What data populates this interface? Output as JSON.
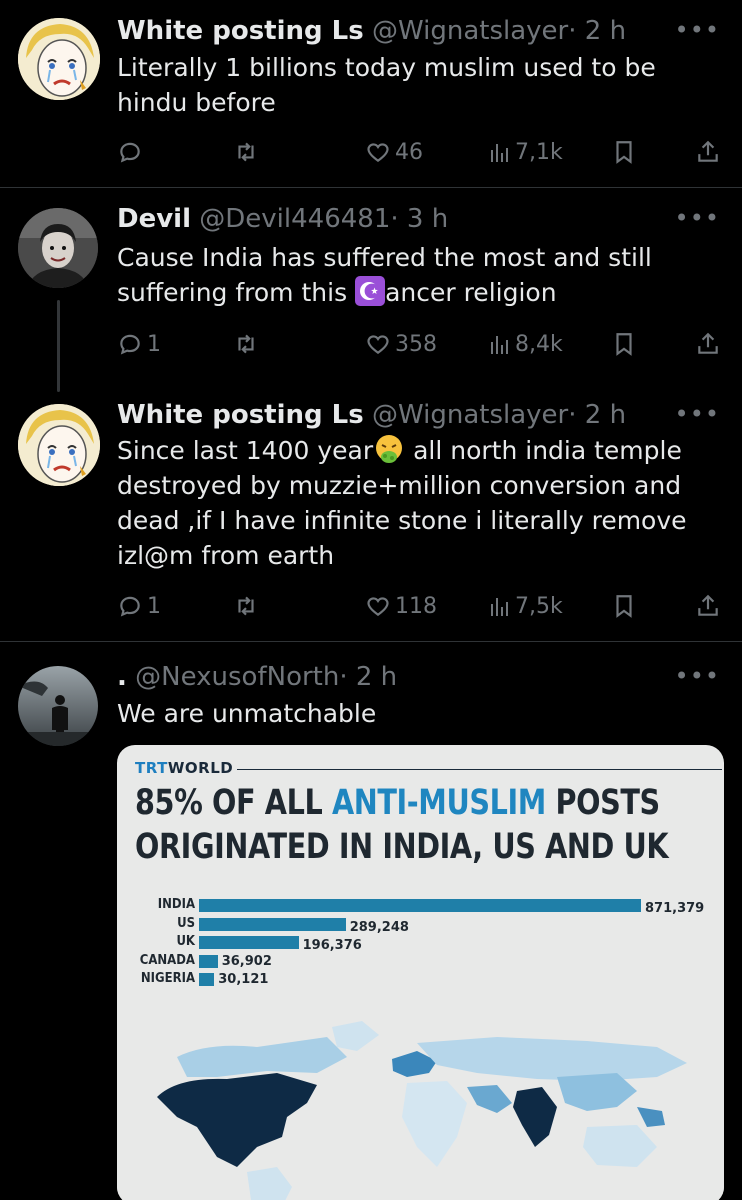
{
  "tweets": [
    {
      "name": "White posting Ls",
      "handle": "@Wignatslayer",
      "time": "· 2 h",
      "text": "Literally 1 billions today muslim used to be hindu before",
      "replies": "",
      "likes": "46",
      "views": "7,1k"
    },
    {
      "name": "Devil",
      "handle": "@Devil446481",
      "time": "· 3 h",
      "text_before": "Cause India has suffered the most and still suffering from this ",
      "text_after": "ancer religion",
      "replies": "1",
      "likes": "358",
      "views": "8,4k"
    },
    {
      "name": "White posting Ls",
      "handle": "@Wignatslayer",
      "time": "· 2 h",
      "text_before": "Since last 1400 year",
      "text_after": " all north india temple destroyed by muzzie+million conversion and dead ,if I have infinite stone i literally remove izl@m from earth",
      "replies": "1",
      "likes": "118",
      "views": "7,5k"
    },
    {
      "name": ".",
      "handle": "@NexusofNorth",
      "time": "· 2 h",
      "text": "We are unmatchable"
    }
  ],
  "more_label": "•••",
  "infographic": {
    "brand_a": "TRT",
    "brand_b": "W",
    "brand_c": "ORLD",
    "headline_1a": "85% OF ALL ",
    "headline_1b": "ANTI-MUSLIM",
    "headline_1c": " POSTS",
    "headline_2": "ORIGINATED IN INDIA, US AND UK",
    "accent": "#1f86c0",
    "bar_color": "#1f7fa8"
  },
  "chart_data": {
    "type": "bar",
    "orientation": "horizontal",
    "categories": [
      "INDIA",
      "US",
      "UK",
      "CANADA",
      "NIGERIA"
    ],
    "values": [
      871379,
      289248,
      196376,
      36902,
      30121
    ],
    "labels": [
      "871,379",
      "289,248",
      "196,376",
      "36,902",
      "30,121"
    ]
  }
}
